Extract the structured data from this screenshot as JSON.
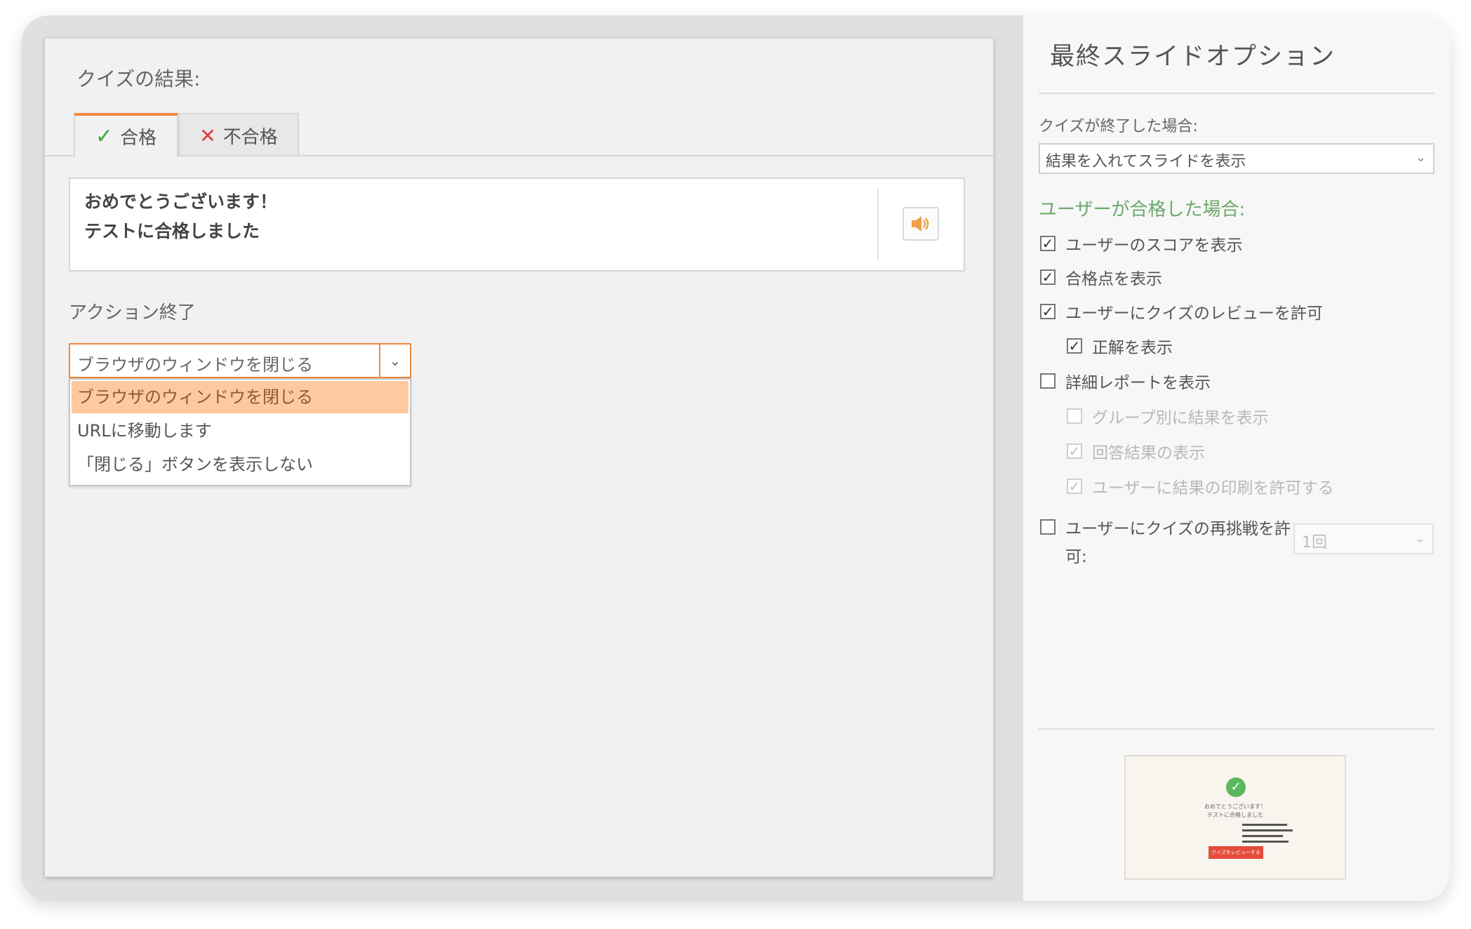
{
  "left": {
    "quiz_result_title": "クイズの結果:",
    "tabs": [
      {
        "label": "合格",
        "icon": "check-icon",
        "active": true
      },
      {
        "label": "不合格",
        "icon": "x-icon",
        "active": false
      }
    ],
    "message_line1": "おめでとうございます！",
    "message_line2": "テストに合格しました",
    "end_action_label": "アクション終了",
    "end_action_value": "ブラウザのウィンドウを閉じる",
    "end_action_options": [
      "ブラウザのウィンドウを閉じる",
      "URLに移動します",
      "「閉じる」ボタンを表示しない"
    ]
  },
  "right": {
    "title": "最終スライドオプション",
    "quiz_end_label": "クイズが終了した場合:",
    "quiz_end_value": "結果を入れてスライドを表示",
    "passed_heading": "ユーザーが合格した場合:",
    "options": [
      {
        "label": "ユーザーのスコアを表示",
        "checked": true,
        "disabled": false
      },
      {
        "label": "合格点を表示",
        "checked": true,
        "disabled": false
      },
      {
        "label": "ユーザーにクイズのレビューを許可",
        "checked": true,
        "disabled": false
      },
      {
        "label": "正解を表示",
        "checked": true,
        "disabled": false
      },
      {
        "label": "詳細レポートを表示",
        "checked": false,
        "disabled": false
      },
      {
        "label": "グループ別に結果を表示",
        "checked": false,
        "disabled": true
      },
      {
        "label": "回答結果の表示",
        "checked": true,
        "disabled": true
      },
      {
        "label": "ユーザーに結果の印刷を許可する",
        "checked": true,
        "disabled": true
      }
    ],
    "retry_label": "ユーザーにクイズの再挑戦を許可:",
    "retry_checked": false,
    "retry_value": "1回"
  },
  "preview": {
    "line1": "おめでとうございます！",
    "line2": "テストに合格しました",
    "button": "クイズをレビューする"
  },
  "colors": {
    "accent_orange": "#f0883e",
    "selected_option": "#ffc9a0",
    "success_green": "#6aa86a",
    "fail_red": "#e03b3b"
  }
}
